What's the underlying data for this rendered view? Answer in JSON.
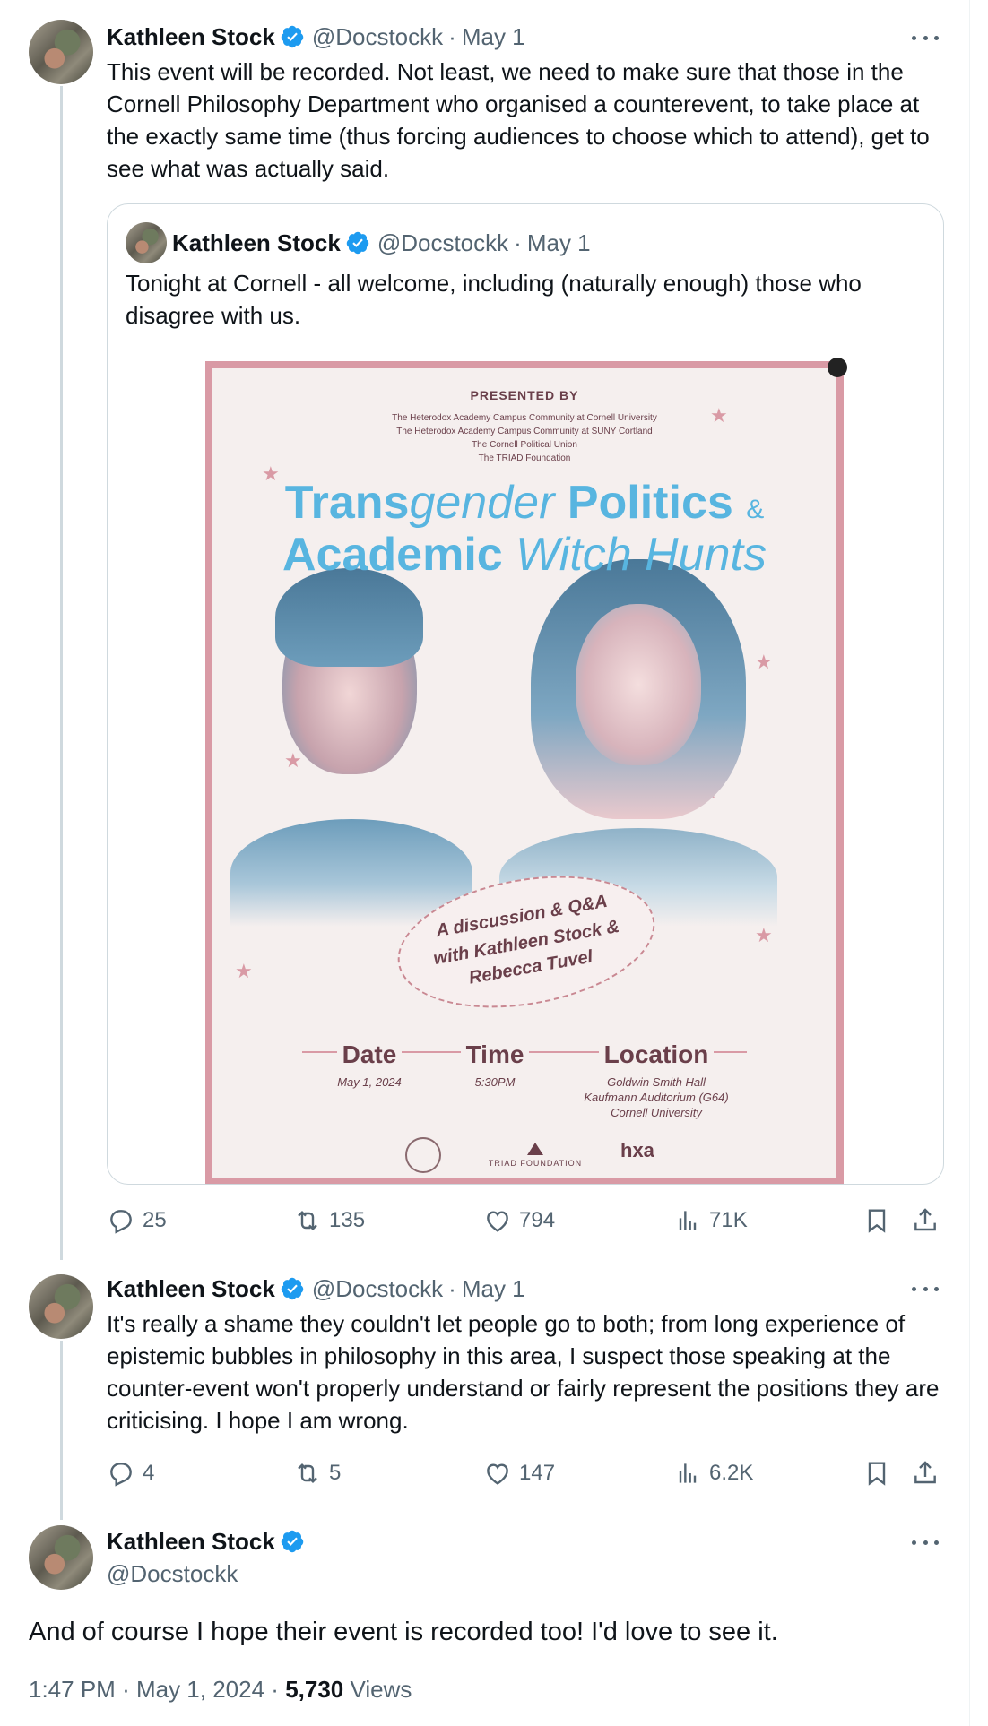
{
  "tweets": [
    {
      "name": "Kathleen Stock",
      "handle": "@Docstockk",
      "sep": "·",
      "date": "May 1",
      "text": "This event will be recorded.  Not least, we need to make sure that those in the Cornell Philosophy Department who organised a counterevent, to take place at the exactly same time (thus forcing audiences to choose which to attend), get to see what was actually said.",
      "quote": {
        "name": "Kathleen Stock",
        "handle": "@Docstockk",
        "sep": "·",
        "date": "May 1",
        "text": "Tonight at Cornell  - all welcome, including (naturally enough) those who disagree with us.",
        "poster": {
          "presented_by": "PRESENTED BY",
          "orgs": [
            "The Heterodox Academy Campus Community at Cornell University",
            "The Heterodox Academy Campus Community at SUNY Cortland",
            "The Cornell Political Union",
            "The TRIAD Foundation"
          ],
          "title_trans": "Trans",
          "title_gender": "gender",
          "title_politics": "Politics",
          "title_amp": "&",
          "title_academic": "Academic",
          "title_witch": "Witch Hunts",
          "badge_line1": "A discussion & Q&A",
          "badge_line2": "with Kathleen Stock &",
          "badge_line3": "Rebecca Tuvel",
          "date_label": "Date",
          "date_value": "May 1, 2024",
          "time_label": "Time",
          "time_value": "5:30PM",
          "location_label": "Location",
          "location_line1": "Goldwin Smith Hall",
          "location_line2": "Kaufmann Auditorium (G64)",
          "location_line3": "Cornell University",
          "triad_logo": "TRIAD FOUNDATION",
          "hxa_logo": "hxa"
        }
      },
      "stats": {
        "replies": "25",
        "reposts": "135",
        "likes": "794",
        "views": "71K"
      }
    },
    {
      "name": "Kathleen Stock",
      "handle": "@Docstockk",
      "sep": "·",
      "date": "May 1",
      "text": "It's really a shame they couldn't let people go to both;  from long experience of epistemic bubbles in philosophy in this area, I suspect those speaking at the counter-event won't properly understand or fairly represent the positions they are criticising. I hope I am wrong.",
      "stats": {
        "replies": "4",
        "reposts": "5",
        "likes": "147",
        "views": "6.2K"
      }
    },
    {
      "name": "Kathleen Stock",
      "handle": "@Docstockk",
      "text": "And of course I hope their event is recorded too! I'd love to see it.",
      "time": "1:47 PM",
      "sep": "·",
      "full_date": "May 1, 2024",
      "view_count": "5,730",
      "views_label": "Views"
    }
  ],
  "colors": {
    "accent": "#1d9bf0",
    "muted": "#536471",
    "text": "#0f1419",
    "border": "#cfd9de"
  },
  "icons": [
    "reply-icon",
    "repost-icon",
    "like-icon",
    "views-icon",
    "bookmark-icon",
    "share-icon",
    "verified-icon",
    "more-icon"
  ]
}
